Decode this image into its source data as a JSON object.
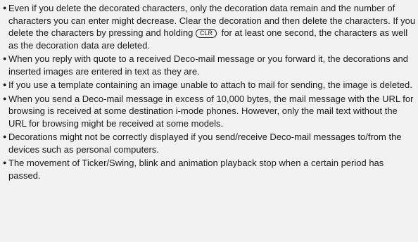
{
  "notes": [
    {
      "text": "Even if you delete the decorated characters, only the decoration data remain and the number of characters you can enter might decrease. Clear the decoration and then delete the characters. If you delete the characters by pressing and holding",
      "key": "CLR",
      "text_after": "for at least one second, the characters as well as the decoration data are deleted."
    },
    {
      "text": "When you reply with quote to a received Deco-mail message or you forward it, the decorations and inserted images are entered in text as they are."
    },
    {
      "text": "If you use a template containing an image unable to attach to mail for sending, the image is deleted."
    },
    {
      "text": "When you send a Deco-mail message in excess of 10,000 bytes, the mail message with the URL for browsing is received at some destination i-mode phones. However, only the mail text without the URL for browsing might be received at some models."
    },
    {
      "text": "Decorations might not be correctly displayed if you send/receive Deco-mail messages to/from the devices such as personal computers."
    },
    {
      "text": "The movement of Ticker/Swing, blink and animation playback stop when a certain period has passed."
    }
  ]
}
